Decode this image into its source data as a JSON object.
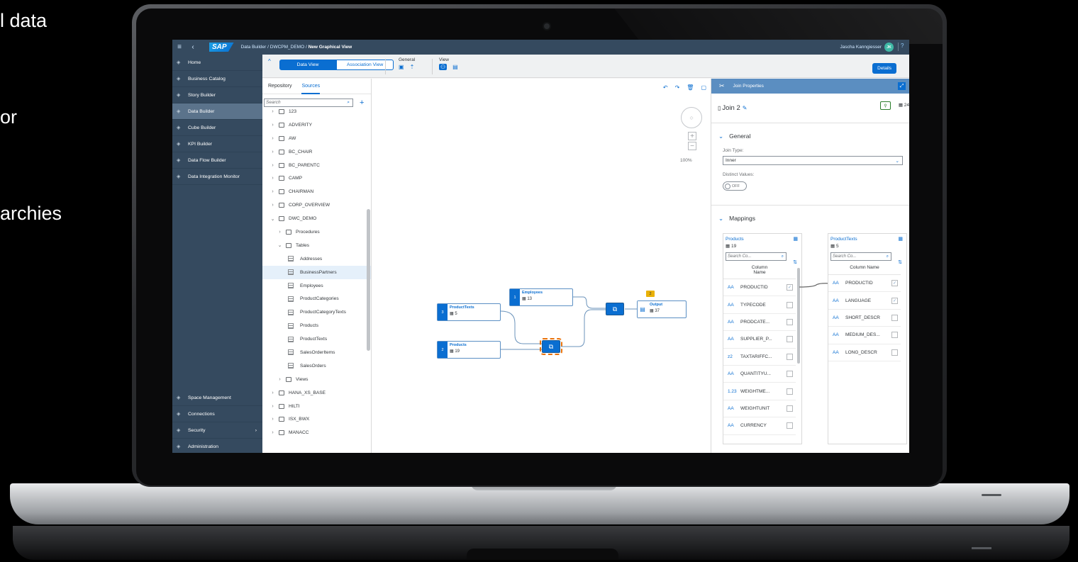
{
  "background_text": {
    "line1": "l data",
    "line2": "or",
    "line3": "archies"
  },
  "shell": {
    "logo": "SAP",
    "breadcrumb_path": "Data Builder / DWCPM_DEMO / ",
    "breadcrumb_current": "New Graphical View",
    "user_name": "Jascha Kanngiesser",
    "user_initials": "JK"
  },
  "nav": {
    "items": [
      {
        "label": "Home",
        "icon": "home-icon"
      },
      {
        "label": "Business Catalog",
        "icon": "catalog-icon"
      },
      {
        "label": "Story Builder",
        "icon": "story-icon"
      },
      {
        "label": "Data Builder",
        "icon": "data-builder-icon",
        "active": true
      },
      {
        "label": "Cube Builder",
        "icon": "cube-icon"
      },
      {
        "label": "KPI Builder",
        "icon": "kpi-icon"
      },
      {
        "label": "Data Flow Builder",
        "icon": "flow-icon"
      },
      {
        "label": "Data Integration Monitor",
        "icon": "monitor-icon"
      }
    ],
    "bottom_items": [
      {
        "label": "Space Management",
        "icon": "space-icon"
      },
      {
        "label": "Connections",
        "icon": "connections-icon"
      },
      {
        "label": "Security",
        "icon": "security-icon"
      },
      {
        "label": "Administration",
        "icon": "admin-icon"
      }
    ]
  },
  "toolbar": {
    "data_view": "Data View",
    "association_view": "Association View",
    "general_label": "General",
    "view_label": "View",
    "details_button": "Details"
  },
  "repository": {
    "tab_repository": "Repository",
    "tab_sources": "Sources",
    "search_placeholder": "Search",
    "tree": [
      {
        "label": "123",
        "level": 0,
        "kind": "folder",
        "expanded": false
      },
      {
        "label": "ADVERITY",
        "level": 0,
        "kind": "folder",
        "expanded": false
      },
      {
        "label": "AW",
        "level": 0,
        "kind": "folder",
        "expanded": false
      },
      {
        "label": "BC_CHAIR",
        "level": 0,
        "kind": "folder",
        "expanded": false
      },
      {
        "label": "BC_PARENTC",
        "level": 0,
        "kind": "folder",
        "expanded": false
      },
      {
        "label": "CAMP",
        "level": 0,
        "kind": "folder",
        "expanded": false
      },
      {
        "label": "CHAIRMAN",
        "level": 0,
        "kind": "folder",
        "expanded": false
      },
      {
        "label": "CORP_OVERVIEW",
        "level": 0,
        "kind": "folder",
        "expanded": false
      },
      {
        "label": "DWC_DEMO",
        "level": 0,
        "kind": "folder",
        "expanded": true
      },
      {
        "label": "Procedures",
        "level": 1,
        "kind": "folder",
        "expanded": false
      },
      {
        "label": "Tables",
        "level": 1,
        "kind": "folder",
        "expanded": true
      },
      {
        "label": "Addresses",
        "level": 2,
        "kind": "table"
      },
      {
        "label": "BusinessPartners",
        "level": 2,
        "kind": "table",
        "selected": true
      },
      {
        "label": "Employees",
        "level": 2,
        "kind": "table"
      },
      {
        "label": "ProductCategories",
        "level": 2,
        "kind": "table"
      },
      {
        "label": "ProductCategoryTexts",
        "level": 2,
        "kind": "table"
      },
      {
        "label": "Products",
        "level": 2,
        "kind": "table"
      },
      {
        "label": "ProductTexts",
        "level": 2,
        "kind": "table"
      },
      {
        "label": "SalesOrderItems",
        "level": 2,
        "kind": "table"
      },
      {
        "label": "SalesOrders",
        "level": 2,
        "kind": "table"
      },
      {
        "label": "Views",
        "level": 1,
        "kind": "folder",
        "expanded": false
      },
      {
        "label": "HANA_XS_BASE",
        "level": 0,
        "kind": "folder",
        "expanded": false
      },
      {
        "label": "HILTI",
        "level": 0,
        "kind": "folder",
        "expanded": false
      },
      {
        "label": "ISX_BWX",
        "level": 0,
        "kind": "folder",
        "expanded": false
      },
      {
        "label": "MANACC",
        "level": 0,
        "kind": "folder",
        "expanded": false
      }
    ]
  },
  "canvas": {
    "zoom": "100%",
    "nodes": {
      "product_texts": {
        "num": "3",
        "title": "ProductTexts",
        "count": "5"
      },
      "products": {
        "num": "2",
        "title": "Products",
        "count": "19"
      },
      "employees": {
        "num": "1",
        "title": "Employees",
        "count": "13"
      },
      "output": {
        "title": "Output",
        "count": "37",
        "badge": "2"
      }
    }
  },
  "properties": {
    "header": "Join Properties",
    "title": "Join 2",
    "count": "24",
    "general_section": "General",
    "join_type_label": "Join Type:",
    "join_type_value": "Inner",
    "distinct_label": "Distinct Values:",
    "distinct_value": "OFF",
    "mappings_section": "Mappings",
    "left": {
      "name": "Products",
      "count": "19",
      "search_placeholder": "Search Co...",
      "col_header_1": "Column",
      "col_header_2": "Name",
      "rows": [
        {
          "type": "AA",
          "name": "PRODUCTID",
          "checked": true
        },
        {
          "type": "AA",
          "name": "TYPECODE",
          "checked": false
        },
        {
          "type": "AA",
          "name": "PRODCATE...",
          "checked": false
        },
        {
          "type": "AA",
          "name": "SUPPLIER_P...",
          "checked": false
        },
        {
          "type": "z2",
          "name": "TAXTARIFFC...",
          "checked": false
        },
        {
          "type": "AA",
          "name": "QUANTITYU...",
          "checked": false
        },
        {
          "type": "1.23",
          "name": "WEIGHTME...",
          "checked": false
        },
        {
          "type": "AA",
          "name": "WEIGHTUNIT",
          "checked": false
        },
        {
          "type": "AA",
          "name": "CURRENCY",
          "checked": false
        }
      ]
    },
    "right": {
      "name": "ProductTexts",
      "count": "5",
      "search_placeholder": "Search Co...",
      "col_header": "Column Name",
      "rows": [
        {
          "type": "AA",
          "name": "PRODUCTID",
          "checked": true
        },
        {
          "type": "AA",
          "name": "LANGUAGE",
          "checked": true
        },
        {
          "type": "AA",
          "name": "SHORT_DESCR",
          "checked": false
        },
        {
          "type": "AA",
          "name": "MEDIUM_DES...",
          "checked": false
        },
        {
          "type": "AA",
          "name": "LONG_DESCR",
          "checked": false
        }
      ]
    }
  },
  "colors": {
    "shell": "#354a5f",
    "accent": "#0a6ed1",
    "selected_outline": "#e9730c"
  }
}
